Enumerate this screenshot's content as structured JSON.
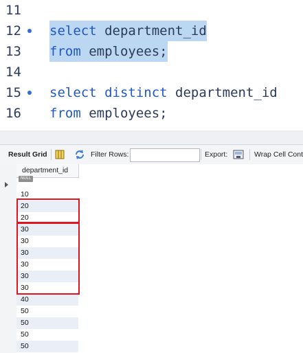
{
  "editor": {
    "lines": [
      {
        "num": "11",
        "marker": false,
        "keyword": "",
        "rest": ""
      },
      {
        "num": "12",
        "marker": true,
        "keyword": "select",
        "rest": " department_id"
      },
      {
        "num": "13",
        "marker": false,
        "keyword": "from",
        "rest": " employees;"
      },
      {
        "num": "14",
        "marker": false,
        "keyword": "",
        "rest": ""
      },
      {
        "num": "15",
        "marker": true,
        "keyword": "select distinct",
        "rest": " department_id"
      },
      {
        "num": "16",
        "marker": false,
        "keyword": "from",
        "rest": " employees;"
      }
    ]
  },
  "toolbar": {
    "result_grid_label": "Result Grid",
    "filter_rows_label": "Filter Rows:",
    "filter_rows_value": "",
    "export_label": "Export:",
    "wrap_cell_label": "Wrap Cell Conte"
  },
  "grid": {
    "column_header": "department_id",
    "null_label": "NULL",
    "rows": [
      "10",
      "20",
      "20",
      "30",
      "30",
      "30",
      "30",
      "30",
      "30",
      "40",
      "50",
      "50",
      "50",
      "50"
    ]
  },
  "colors": {
    "keyword": "#2058c8",
    "selection": "#bcd7f2",
    "highlight_box": "#e0141e",
    "alt_row": "#e9eef7"
  }
}
